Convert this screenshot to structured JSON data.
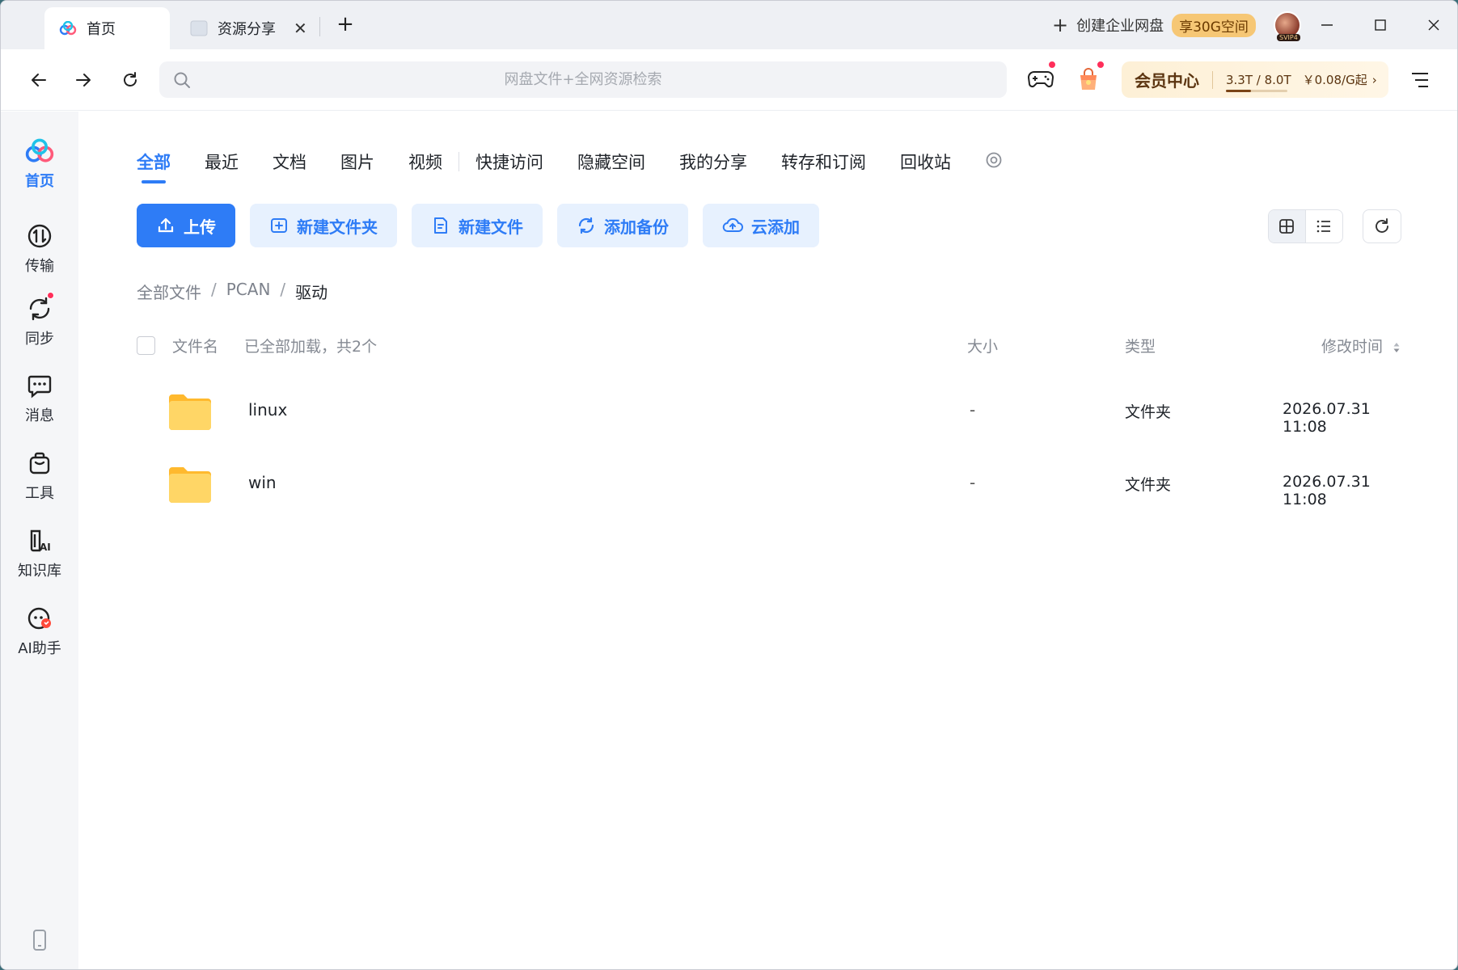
{
  "titlebar": {
    "tabs": [
      {
        "label": "首页",
        "icon": "baidu-netdisk-logo-icon",
        "active": true
      },
      {
        "label": "资源分享",
        "icon": "page-icon",
        "active": false
      }
    ],
    "new_tab_label": "+",
    "create_enterprise": "创建企业网盘",
    "enterprise_badge": "享30G空间",
    "avatar_badge": "SVIP4"
  },
  "navbar": {
    "search_placeholder": "网盘文件+全网资源检索",
    "vip": {
      "title": "会员中心",
      "quota": "3.3T / 8.0T",
      "quota_fraction": 0.41,
      "price": "￥0.08/G起",
      "chevron": "›"
    }
  },
  "sidebar": {
    "items": [
      {
        "label": "首页",
        "icon": "home-logo-icon",
        "active": true
      },
      {
        "label": "传输",
        "icon": "transfer-icon"
      },
      {
        "label": "同步",
        "icon": "sync-icon"
      },
      {
        "label": "消息",
        "icon": "message-icon"
      },
      {
        "label": "工具",
        "icon": "toolbox-icon"
      },
      {
        "label": "知识库",
        "icon": "knowledge-base-icon"
      },
      {
        "label": "AI助手",
        "icon": "ai-assistant-icon"
      }
    ]
  },
  "categories": [
    "全部",
    "最近",
    "文档",
    "图片",
    "视频",
    "快捷访问",
    "隐藏空间",
    "我的分享",
    "转存和订阅",
    "回收站"
  ],
  "actions": {
    "upload": "上传",
    "new_folder": "新建文件夹",
    "new_file": "新建文件",
    "add_backup": "添加备份",
    "cloud_add": "云添加"
  },
  "breadcrumb": [
    "全部文件",
    "PCAN",
    "驱动"
  ],
  "breadcrumb_sep": "/",
  "table": {
    "col_name": "文件名",
    "load_status": "已全部加载，共2个",
    "col_size": "大小",
    "col_type": "类型",
    "col_modified": "修改时间",
    "rows": [
      {
        "name": "linux",
        "size": "-",
        "type": "文件夹",
        "modified": "2026.07.31 11:08"
      },
      {
        "name": "win",
        "size": "-",
        "type": "文件夹",
        "modified": "2026.07.31 11:08"
      }
    ]
  },
  "colors": {
    "accent": "#2e7cf6",
    "folder": "#ffc940",
    "badge": "#f6c775",
    "red_dot": "#ff2f5a"
  }
}
